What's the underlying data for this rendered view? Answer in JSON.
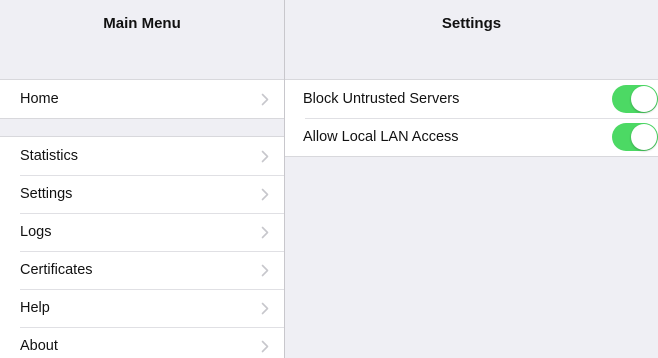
{
  "master": {
    "title": "Main Menu",
    "items_group1": [
      {
        "label": "Home"
      }
    ],
    "items_group2": [
      {
        "label": "Statistics"
      },
      {
        "label": "Settings"
      },
      {
        "label": "Logs"
      },
      {
        "label": "Certificates"
      },
      {
        "label": "Help"
      },
      {
        "label": "About"
      }
    ],
    "chevron_icon": "chevron-right-icon"
  },
  "detail": {
    "title": "Settings",
    "toggles": [
      {
        "label": "Block Untrusted Servers",
        "on": true
      },
      {
        "label": "Allow Local LAN Access",
        "on": true
      }
    ],
    "toggle_on_color": "#4cd964"
  }
}
